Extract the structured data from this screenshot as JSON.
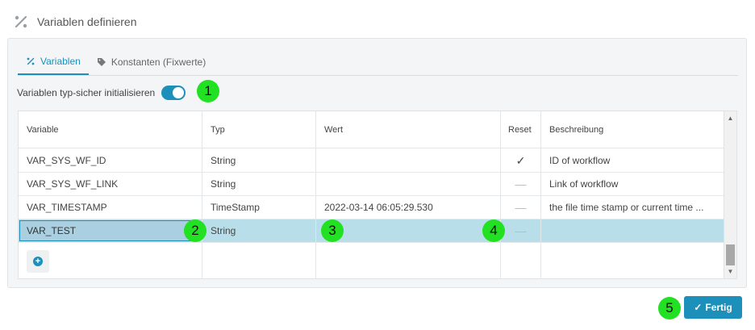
{
  "header": {
    "title": "Variablen definieren",
    "icon": "percent-icon"
  },
  "tabs": [
    {
      "label": "Variablen",
      "icon": "percent-icon",
      "active": true
    },
    {
      "label": "Konstanten (Fixwerte)",
      "icon": "tag-icon",
      "active": false
    }
  ],
  "toggle": {
    "label": "Variablen typ-sicher initialisieren",
    "on": true
  },
  "grid": {
    "columns": {
      "variable": "Variable",
      "typ": "Typ",
      "wert": "Wert",
      "reset": "Reset",
      "beschreibung": "Beschreibung"
    },
    "rows": [
      {
        "variable": "VAR_SYS_WF_ID",
        "typ": "String",
        "wert": "",
        "reset": "✓",
        "beschreibung": "ID of workflow"
      },
      {
        "variable": "VAR_SYS_WF_LINK",
        "typ": "String",
        "wert": "",
        "reset": "—",
        "beschreibung": "Link of workflow"
      },
      {
        "variable": "VAR_TIMESTAMP",
        "typ": "TimeStamp",
        "wert": "2022-03-14 06:05:29.530",
        "reset": "—",
        "beschreibung": "the file time stamp or current time ..."
      },
      {
        "variable": "VAR_TEST",
        "typ": "String",
        "wert": "",
        "reset": "—",
        "beschreibung": ""
      }
    ],
    "add_icon": "plus-circle-icon"
  },
  "badges": [
    "1",
    "2",
    "3",
    "4",
    "5"
  ],
  "footer": {
    "done_label": "Fertig",
    "done_icon": "check-icon"
  },
  "colors": {
    "accent": "#1c8fba",
    "selected_row": "#b8dfe9",
    "badge": "#22e022"
  }
}
